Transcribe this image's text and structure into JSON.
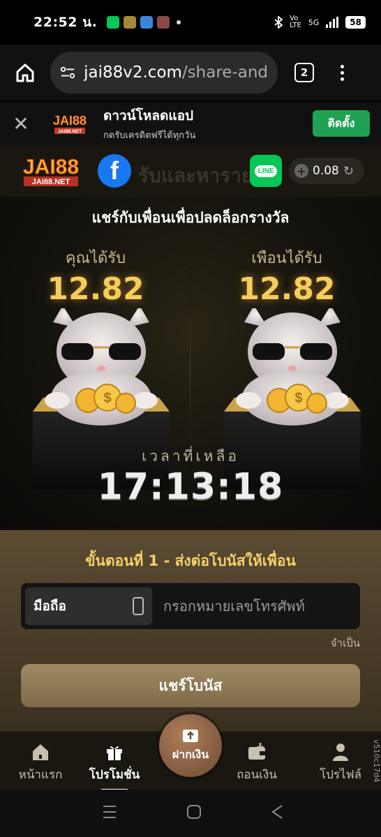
{
  "status_bar": {
    "time": "22:52 น.",
    "network": "5G",
    "battery": "58"
  },
  "browser": {
    "url_domain": "jai88v2.com",
    "url_path": "/share-and-e",
    "tab_count": "2"
  },
  "install_banner": {
    "logo_text": "JAI88",
    "logo_sub": "JAI88.NET",
    "title": "ดาวน์โหลดแอป",
    "subtitle": "กดรับเครดิตฟรีได้ทุกวัน",
    "install_label": "ติดตั้ง"
  },
  "site_header": {
    "logo_text": "JAI88",
    "logo_sub": "JAI88.NET",
    "background_title": "รับและหาราย",
    "facebook_letter": "f",
    "line_label": "LINE",
    "balance": "0.08"
  },
  "hero": {
    "title": "แชร์กับเพื่อนเพื่อปลดล็อกรางวัล",
    "you_receive_label": "คุณได้รับ",
    "you_receive_value": "12.82",
    "friend_receive_label": "เพือนได้รับ",
    "friend_receive_value": "12.82",
    "time_left_label": "เวลาที่เหลือ",
    "time_left_value": "17:13:18"
  },
  "form": {
    "step_title": "ขั้นตอนที่ 1 - ส่งต่อโบนัสให้เพื่อน",
    "phone_type_label": "มือถือ",
    "phone_placeholder": "กรอกหมายเลขโทรศัพท์",
    "phone_value": "",
    "required_note": "จำเป็น",
    "share_button": "แชร์โบนัส"
  },
  "bottom_nav": {
    "items": [
      {
        "label": "หน้าแรก",
        "icon": "home-icon"
      },
      {
        "label": "โปรโมชั่น",
        "icon": "gift-icon"
      },
      {
        "label": "ถอนเงิน",
        "icon": "wallet-icon"
      },
      {
        "label": "โปรไฟล์",
        "icon": "user-icon"
      }
    ],
    "deposit_label": "ฝากเงิน",
    "version": "v510c17d4"
  },
  "colors": {
    "accent_gold": "#f6cc5c",
    "install_green": "#20a154",
    "facebook_blue": "#1877f2",
    "line_green": "#06c755"
  }
}
